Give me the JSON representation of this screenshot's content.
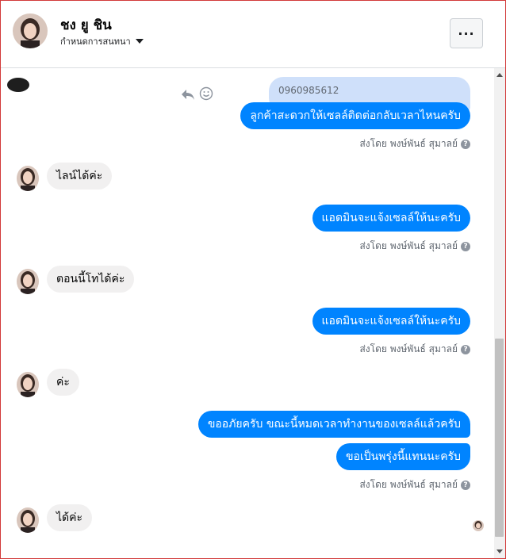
{
  "header": {
    "name": "ชง ยู ชิน",
    "subtitle": "กำหนดการสนทนา",
    "more_label": "···"
  },
  "messages": {
    "m1_reply_preview": "0960985612",
    "m1_text": "ลูกค้าสะดวกให้เซลล์ติดต่อกลับเวลาไหนครับ",
    "m1_sentby": "ส่งโดย พงษ์พันธ์ สุมาลย์",
    "m2_text": "ไลน์ได้ค่ะ",
    "m3_text": "แอดมินจะแจ้งเซลล์ให้นะครับ",
    "m3_sentby": "ส่งโดย พงษ์พันธ์ สุมาลย์",
    "m4_text": "ตอนนี้โทได้ค่ะ",
    "m5_text": "แอดมินจะแจ้งเซลล์ให้นะครับ",
    "m5_sentby": "ส่งโดย พงษ์พันธ์ สุมาลย์",
    "m6_text": "ค่ะ",
    "m7_text": "ขออภัยครับ ขณะนี้หมดเวลาทำงานของเซลล์แล้วครับ",
    "m8_text": "ขอเป็นพรุ่งนี้แทนนะครับ",
    "m8_sentby": "ส่งโดย พงษ์พันธ์ สุมาลย์",
    "m9_text": "ได้ค่ะ"
  },
  "icons": {
    "help": "question-circle-icon",
    "reply": "reply-icon",
    "emoji": "smile-icon",
    "more": "more-dots-icon",
    "dropdown": "caret-down-icon"
  },
  "colors": {
    "outgoing_bubble": "#0084ff",
    "incoming_bubble": "#f1f0f0",
    "reply_preview": "#cfe0fa"
  }
}
